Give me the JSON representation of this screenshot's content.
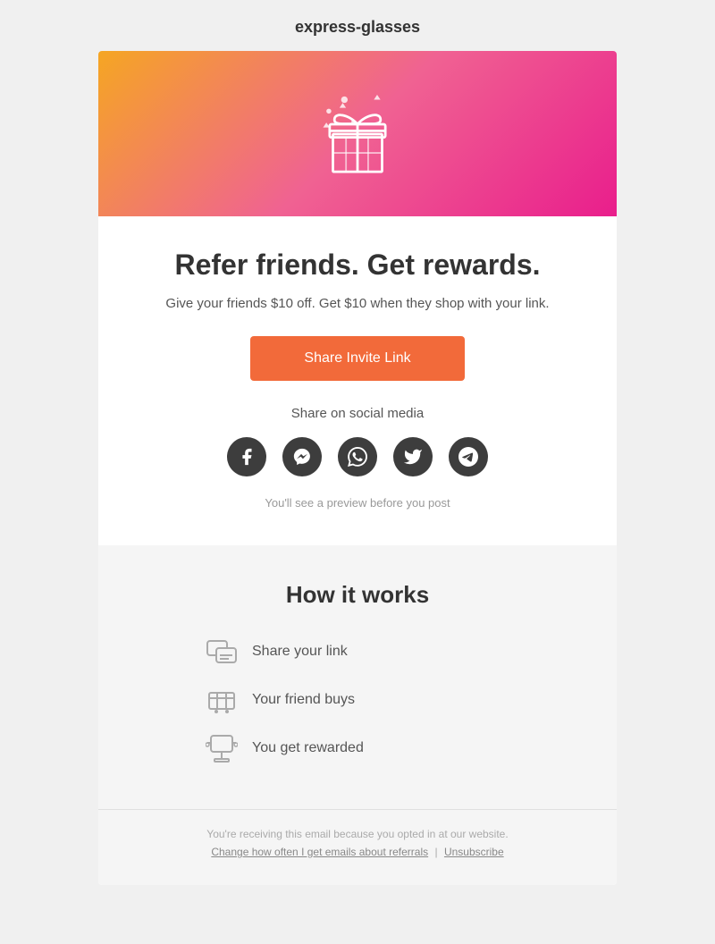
{
  "header": {
    "title": "express-glasses"
  },
  "hero": {
    "alt": "Gift box with decorative elements"
  },
  "content": {
    "heading": "Refer friends. Get rewards.",
    "subtext": "Give your friends $10 off. Get $10 when they shop with your link.",
    "cta_label": "Share Invite Link",
    "social_label": "Share on social media",
    "preview_text": "You'll see a preview before you post"
  },
  "how_it_works": {
    "title": "How it works",
    "steps": [
      {
        "text": "Share your link",
        "icon": "share-icon"
      },
      {
        "text": "Your friend buys",
        "icon": "cart-icon"
      },
      {
        "text": "You get rewarded",
        "icon": "reward-icon"
      }
    ]
  },
  "footer": {
    "notice": "You're receiving this email because you opted in at our website.",
    "change_label": "Change how often I get emails about referrals",
    "separator": "|",
    "unsubscribe_label": "Unsubscribe"
  },
  "social_icons": [
    {
      "name": "facebook",
      "label": "Facebook"
    },
    {
      "name": "messenger",
      "label": "Messenger"
    },
    {
      "name": "whatsapp",
      "label": "WhatsApp"
    },
    {
      "name": "twitter",
      "label": "Twitter"
    },
    {
      "name": "telegram",
      "label": "Telegram"
    }
  ]
}
